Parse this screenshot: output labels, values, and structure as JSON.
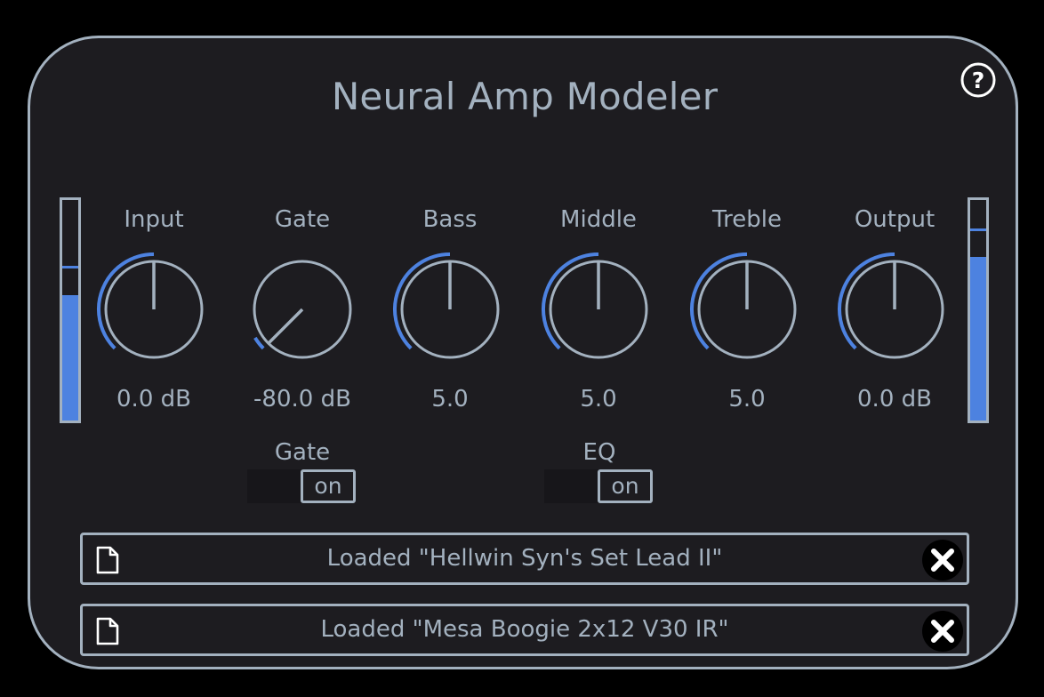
{
  "title": "Neural Amp Modeler",
  "icons": {
    "help": "help-circle-icon",
    "file": "file-icon",
    "clear": "close-icon"
  },
  "colors": {
    "accent": "#4d82e0",
    "foreground": "#a3b1bf",
    "panel": "#1d1c20",
    "background": "#000000"
  },
  "meters": {
    "input": {
      "level": 0.57,
      "peak": 0.69
    },
    "output": {
      "level": 0.74,
      "peak": 0.86
    }
  },
  "knobs": [
    {
      "id": "input",
      "label": "Input",
      "value": "0.0 dB",
      "position": 0.5
    },
    {
      "id": "gate",
      "label": "Gate",
      "value": "-80.0 dB",
      "position": 0.0
    },
    {
      "id": "bass",
      "label": "Bass",
      "value": "5.0",
      "position": 0.5
    },
    {
      "id": "middle",
      "label": "Middle",
      "value": "5.0",
      "position": 0.5
    },
    {
      "id": "treble",
      "label": "Treble",
      "value": "5.0",
      "position": 0.5
    },
    {
      "id": "output",
      "label": "Output",
      "value": "0.0 dB",
      "position": 0.5
    }
  ],
  "switches": [
    {
      "id": "gate",
      "label": "Gate",
      "state": "on"
    },
    {
      "id": "eq",
      "label": "EQ",
      "state": "on"
    }
  ],
  "files": [
    {
      "id": "model",
      "text": "Loaded \"Hellwin Syn's Set Lead II\""
    },
    {
      "id": "ir",
      "text": "Loaded \"Mesa Boogie 2x12 V30 IR\""
    }
  ]
}
